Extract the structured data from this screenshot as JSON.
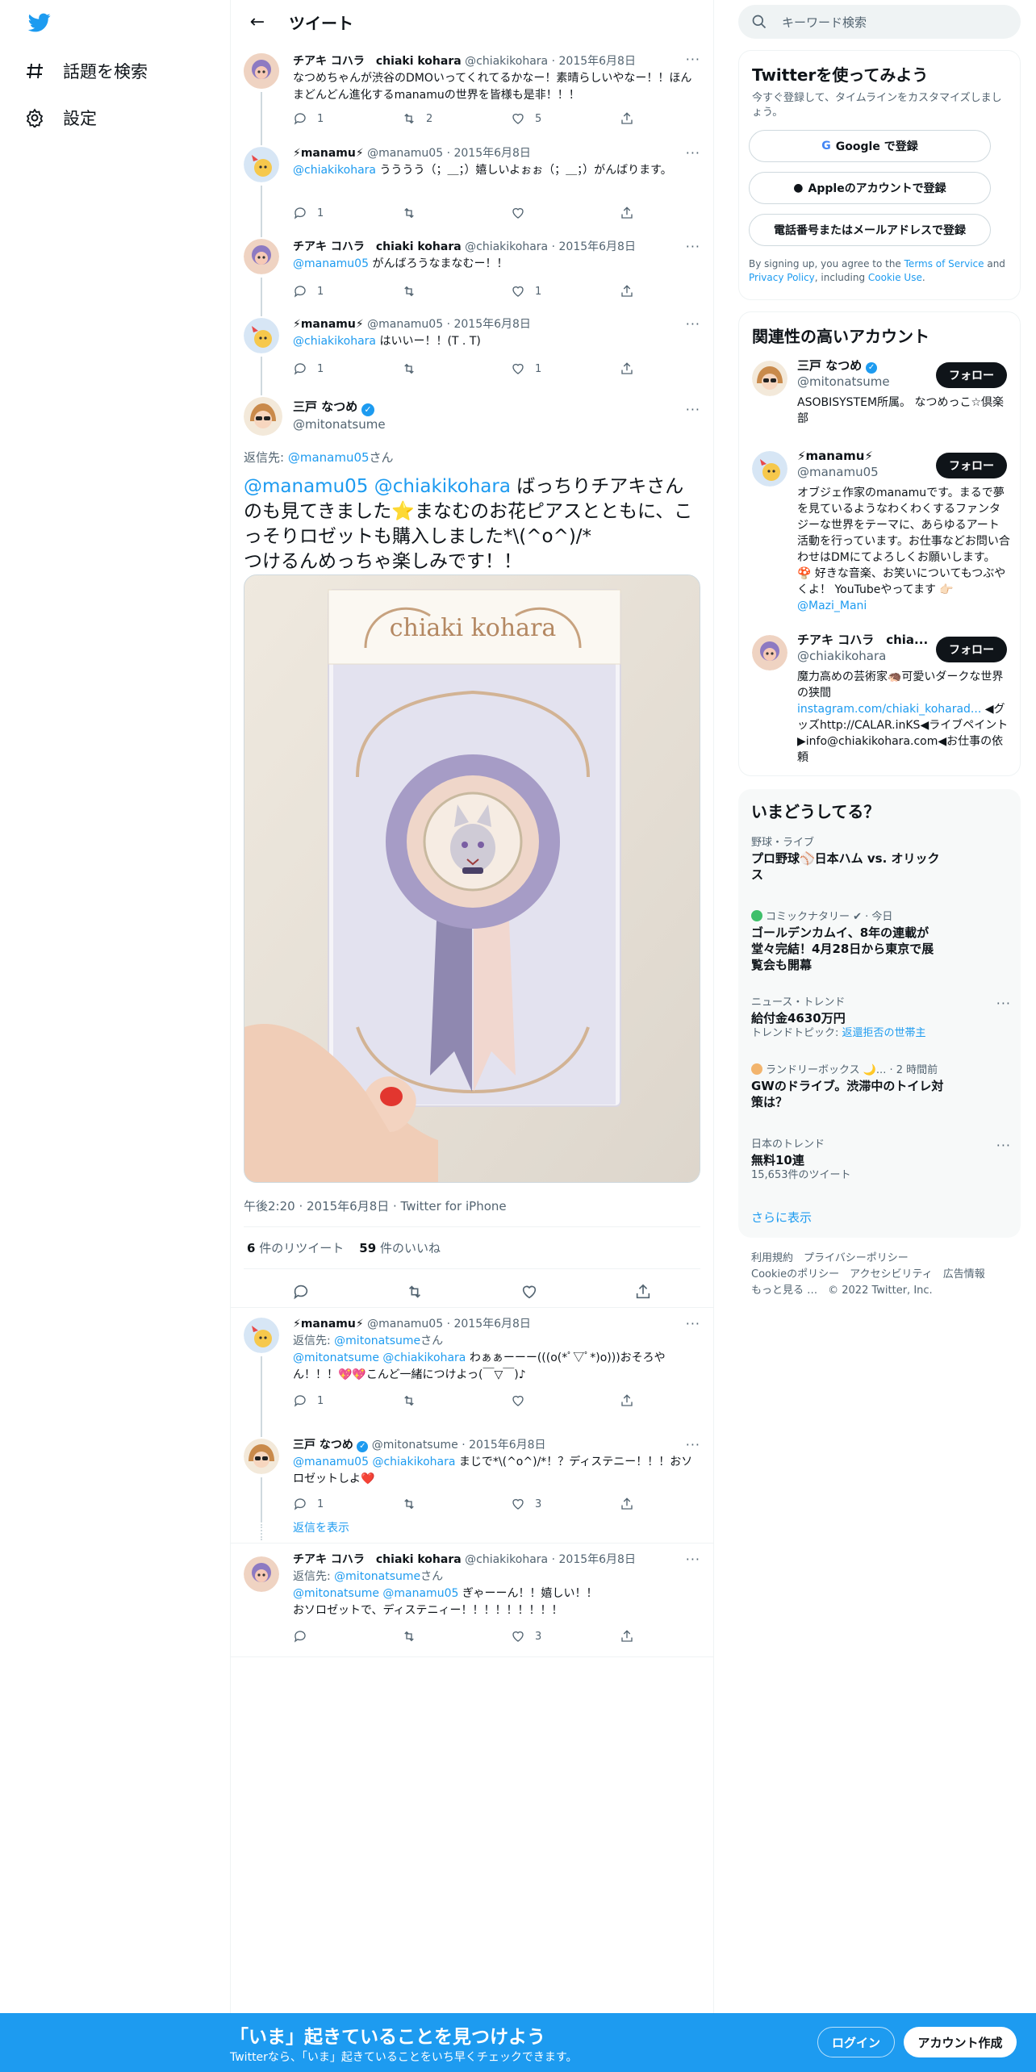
{
  "nav": {
    "explore_label": "話題を検索",
    "settings_label": "設定"
  },
  "header": {
    "title": "ツイート"
  },
  "tweets": [
    {
      "name": "チアキ コハラ　chiaki kohara",
      "handle": "@chiakikohara",
      "date": "2015年6月8日",
      "text": "なつめちゃんが渋谷のDMOいってくれてるかなー！素晴らしいやなー！！ほんまどんどん進化するmanamuの世界を皆様も是非！！！",
      "reply": "1",
      "retweet": "2",
      "like": "5"
    },
    {
      "name": "⚡manamu⚡",
      "handle": "@manamu05",
      "date": "2015年6月8日",
      "mention": "@chiakikohara",
      "text": " うううう（；＿；）嬉しいよぉぉ（；＿；）がんばります。",
      "reply": "1",
      "retweet": "",
      "like": ""
    },
    {
      "name": "チアキ コハラ　chiaki kohara",
      "handle": "@chiakikohara",
      "date": "2015年6月8日",
      "mention": "@manamu05",
      "text": " がんばろうなまなむー！！",
      "reply": "1",
      "retweet": "",
      "like": "1"
    },
    {
      "name": "⚡manamu⚡",
      "handle": "@manamu05",
      "date": "2015年6月8日",
      "mention": "@chiakikohara",
      "text": " はいいー！！(T . T)",
      "reply": "1",
      "retweet": "",
      "like": "1"
    }
  ],
  "focus": {
    "name": "三戸 なつめ",
    "handle": "@mitonatsume",
    "reply_to_label": "返信先: ",
    "reply_to_handle": "@manamu05",
    "reply_to_suffix": "さん",
    "mention1": "@manamu05",
    "mention2": "@chiakikohara",
    "text": " ばっちりチアキさんのも見てきました⭐まなむのお花ピアスとともに、こっそりロゼットも購入しました*\\(^o^)/*\nつけるんめっちゃ楽しみです！！",
    "image_title": "chiaki kohara",
    "meta": "午後2:20 · 2015年6月8日 · Twitter for iPhone",
    "retweets": "6",
    "retweets_label": " 件のリツイート",
    "likes": "59",
    "likes_label": " 件のいいね"
  },
  "replies": [
    {
      "name": "⚡manamu⚡",
      "handle": "@manamu05",
      "date": "2015年6月8日",
      "reply_to": "@mitonatsume",
      "reply_suffix": "さん",
      "mention": "@mitonatsume @chiakikohara",
      "text": " わぁぁーーー(((o(*ﾟ▽ﾟ*)o)))おそろやん！！！💖💖こんど一緒につけよっ(￣▽￣)♪",
      "reply": "1",
      "retweet": "",
      "like": ""
    },
    {
      "name": "三戸 なつめ",
      "handle": "@mitonatsume",
      "date": "2015年6月8日",
      "mention": "@manamu05 @chiakikohara",
      "text": " まじで*\\(^o^)/*！？ディステニー！！！おソロゼットしよ❤️",
      "reply": "1",
      "retweet": "",
      "like": "3"
    },
    {
      "name": "チアキ コハラ　chiaki kohara",
      "handle": "@chiakikohara",
      "date": "2015年6月8日",
      "reply_to": "@mitonatsume",
      "reply_suffix": "さん",
      "mention": "@mitonatsume @manamu05",
      "text": " ぎゃーーん！！嬉しい！！\nおソロゼットで、ディステニィー！！！！！！！！！",
      "reply": "",
      "retweet": "",
      "like": "3"
    }
  ],
  "show_replies": "返信を表示",
  "search": {
    "placeholder": "キーワード検索"
  },
  "signup": {
    "title": "Twitterを使ってみよう",
    "sub": "今すぐ登録して、タイムラインをカスタマイズしましょう。",
    "google": "Google で登録",
    "apple": "Appleのアカウントで登録",
    "phone": "電話番号またはメールアドレスで登録",
    "legal1": "By signing up, you agree to the ",
    "tos": "Terms of Service",
    "legal2": " and ",
    "privacy": "Privacy Policy",
    "legal3": ", including ",
    "cookie": "Cookie Use",
    "legal4": "."
  },
  "related": {
    "title": "関連性の高いアカウント",
    "follow": "フォロー",
    "accounts": [
      {
        "name": "三戸 なつめ",
        "handle": "@mitonatsume",
        "bio": "ASOBISYSTEM所属。 なつめっこ☆倶楽部"
      },
      {
        "name": "⚡manamu⚡",
        "handle": "@manamu05",
        "bio": "オブジェ作家のmanamuです。まるで夢を見ているようなわくわくするファンタジーな世界をテーマに、あらゆるアート活動を行っています。お仕事などお問い合わせはDMにてよろしくお願いします。 🍄 好きな音楽、お笑いについてもつぶやくよ！ YouTubeやってます 👉🏻 ",
        "bio_link": "@Mazi_Mani"
      },
      {
        "name": "チアキ コハラ　chia...",
        "handle": "@chiakikohara",
        "bio": "魔力高めの芸術家🦔可愛いダークな世界の狭間",
        "bio_link": "instagram.com/chiaki_koharad...",
        "bio2": " ◀グッズhttp://CALAR.inKS◀ライブペイント▶info@chiakikohara.com◀お仕事の依頼"
      }
    ]
  },
  "trends": {
    "title": "いまどうしてる？",
    "items": [
      {
        "meta": "野球・ライブ",
        "title": "プロ野球⚾日本ハム vs. オリックス"
      },
      {
        "meta": "コミックナタリー ✔ · 今日",
        "title": "ゴールデンカムイ、8年の連載が堂々完結！4月28日から東京で展覧会も開幕"
      },
      {
        "meta": "ニュース・トレンド",
        "title": "給付金4630万円",
        "sub": "トレンドトピック: ",
        "sub_link": "返還拒否の世帯主"
      },
      {
        "meta": "ランドリーボックス 🌙... · 2 時間前",
        "title": "GWのドライブ。渋滞中のトイレ対策は？"
      },
      {
        "meta": "日本のトレンド",
        "title": "無料10連",
        "sub": "15,653件のツイート"
      }
    ],
    "more": "さらに表示"
  },
  "footer_links": {
    "line1": "利用規約　プライバシーポリシー",
    "line2": "Cookieのポリシー　アクセシビリティ　広告情報",
    "line3": "もっと見る …　© 2022 Twitter, Inc."
  },
  "bottom": {
    "title": "「いま」起きていることを見つけよう",
    "sub": "Twitterなら、「いま」起きていることをいち早くチェックできます。",
    "login": "ログイン",
    "signup": "アカウント作成"
  }
}
